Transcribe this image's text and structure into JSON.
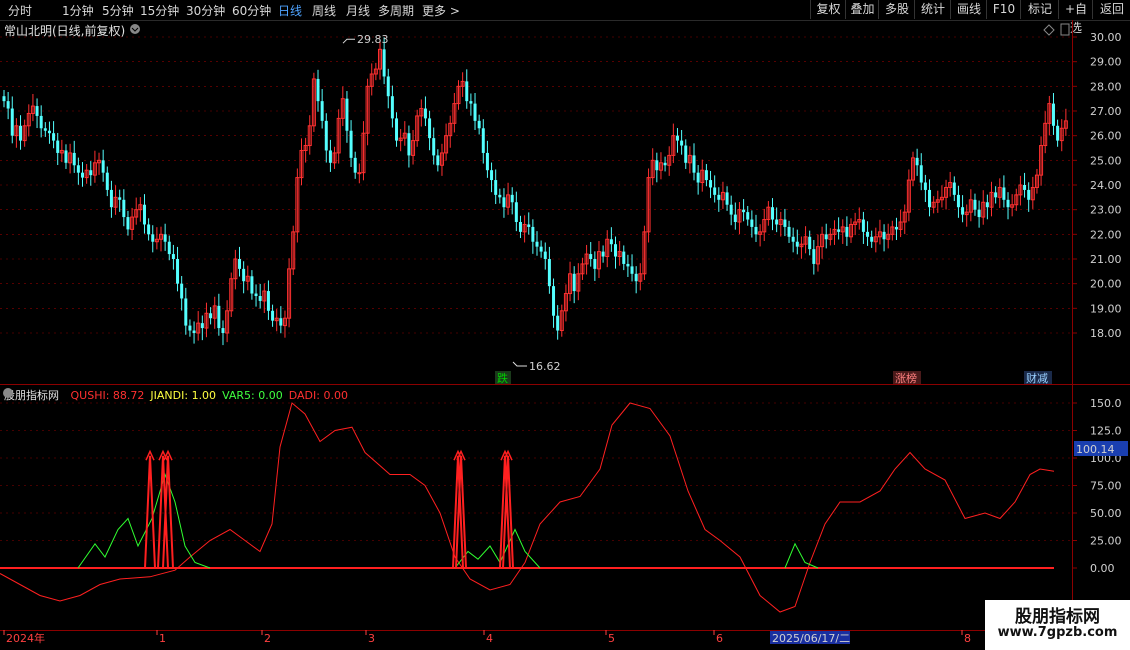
{
  "toolbar": {
    "periods": [
      "分时",
      "1分钟",
      "5分钟",
      "15分钟",
      "30分钟",
      "60分钟",
      "日线",
      "周线",
      "月线",
      "多周期",
      "更多 >"
    ],
    "active_period": "日线",
    "actions": [
      "复权",
      "叠加",
      "多股",
      "统计",
      "画线",
      "F10",
      "标记",
      "+自选",
      "返回"
    ]
  },
  "main_chart": {
    "title": "常山北明(日线,前复权)",
    "price_ticks": [
      "30.00",
      "29.00",
      "28.00",
      "27.00",
      "26.00",
      "25.00",
      "24.00",
      "23.00",
      "22.00",
      "21.00",
      "20.00",
      "19.00",
      "18.00"
    ],
    "high_label": "29.83",
    "low_label": "16.62",
    "signals": [
      {
        "text": "跌",
        "color": "#00d000",
        "bg": "#1a3a1a"
      },
      {
        "text": "涨榜",
        "color": "#ff8080",
        "bg": "#4a1a1a"
      },
      {
        "text": "财减",
        "color": "#9ad0ff",
        "bg": "#1a2a4a"
      }
    ]
  },
  "indicator": {
    "name": "股朋指标网",
    "values": [
      {
        "label": "QUSHI: 88.72",
        "color": "#ff3030"
      },
      {
        "label": "JIANDI: 1.00",
        "color": "#ffff40"
      },
      {
        "label": "VAR5: 0.00",
        "color": "#40ff40"
      },
      {
        "label": "DADI: 0.00",
        "color": "#ff3030"
      }
    ],
    "ticks": [
      "150.0",
      "125.0",
      "100.0",
      "75.00",
      "50.00",
      "25.00",
      "0.00"
    ],
    "current_value": "100.14"
  },
  "date_axis": {
    "labels": [
      "2024年",
      "1",
      "2",
      "3",
      "4",
      "5",
      "6",
      "8"
    ],
    "cursor_date": "2025/06/17/二"
  },
  "watermark": {
    "line1": "股朋指标网",
    "line2": "www.7gpzb.com"
  },
  "colors": {
    "up": "#ff3030",
    "down": "#54ffff",
    "grid": "#8b0000",
    "quishi": "#ff2020",
    "var5": "#30ff30"
  },
  "chart_data": {
    "type": "candlestick",
    "title": "常山北明(日线,前复权)",
    "ylim": [
      17.3,
      30.3
    ],
    "closes": [
      27.4,
      27.1,
      26.0,
      26.4,
      25.8,
      26.4,
      26.9,
      27.2,
      26.8,
      26.3,
      26.2,
      26.1,
      25.8,
      25.3,
      25.4,
      24.9,
      25.3,
      24.8,
      24.5,
      24.3,
      24.6,
      24.4,
      24.9,
      25.0,
      24.5,
      23.8,
      23.1,
      23.5,
      23.4,
      22.7,
      22.2,
      22.7,
      23.0,
      23.2,
      22.4,
      22.0,
      21.7,
      21.8,
      22.0,
      21.7,
      21.2,
      21.0,
      20.0,
      19.4,
      18.3,
      18.1,
      18.0,
      18.4,
      18.2,
      18.8,
      18.6,
      19.1,
      18.2,
      18.0,
      18.9,
      20.2,
      21.0,
      20.6,
      20.1,
      20.3,
      19.6,
      19.5,
      19.3,
      19.7,
      18.9,
      18.5,
      18.6,
      18.3,
      18.6,
      20.6,
      22.1,
      24.3,
      25.4,
      25.6,
      26.4,
      28.3,
      27.4,
      26.6,
      25.4,
      24.9,
      25.3,
      26.7,
      27.5,
      26.2,
      25.1,
      24.5,
      24.5,
      26.1,
      28.0,
      28.5,
      28.7,
      29.5,
      28.4,
      27.6,
      26.7,
      25.8,
      25.9,
      26.1,
      25.2,
      25.8,
      26.8,
      27.1,
      26.7,
      25.9,
      25.2,
      24.8,
      25.3,
      26.0,
      26.5,
      27.3,
      28.0,
      28.2,
      27.4,
      27.3,
      26.6,
      26.3,
      25.3,
      24.6,
      24.2,
      23.6,
      23.5,
      23.1,
      23.6,
      23.3,
      22.5,
      22.1,
      22.4,
      22.3,
      21.7,
      21.5,
      21.3,
      21.0,
      19.9,
      18.7,
      18.1,
      18.9,
      19.6,
      20.4,
      19.7,
      20.4,
      20.8,
      21.2,
      21.0,
      20.6,
      21.3,
      21.1,
      21.8,
      21.6,
      21.1,
      21.3,
      20.8,
      20.7,
      20.4,
      20.1,
      20.4,
      22.1,
      24.3,
      25.0,
      24.6,
      24.9,
      24.8,
      25.2,
      26.0,
      25.8,
      25.6,
      24.9,
      25.2,
      24.5,
      24.1,
      24.6,
      24.2,
      23.9,
      23.6,
      23.4,
      23.7,
      23.2,
      22.8,
      22.5,
      23.0,
      22.9,
      22.6,
      22.3,
      22.0,
      22.1,
      22.6,
      23.1,
      22.6,
      22.4,
      22.6,
      22.3,
      21.9,
      21.7,
      21.5,
      21.6,
      21.9,
      21.4,
      20.8,
      21.5,
      22.0,
      21.8,
      22.0,
      22.2,
      22.1,
      22.3,
      21.9,
      22.4,
      22.5,
      22.6,
      22.1,
      21.9,
      21.7,
      21.9,
      22.1,
      21.8,
      22.0,
      22.3,
      22.2,
      22.5,
      22.9,
      24.2,
      25.1,
      24.8,
      24.1,
      23.8,
      23.1,
      23.3,
      23.4,
      23.5,
      23.9,
      24.1,
      23.6,
      23.1,
      22.8,
      22.9,
      23.4,
      23.0,
      22.7,
      23.3,
      23.1,
      23.7,
      23.5,
      23.9,
      23.4,
      23.1,
      23.2,
      23.6,
      24.0,
      23.8,
      23.4,
      23.9,
      24.4,
      25.6,
      26.5,
      27.3,
      26.4,
      25.8,
      26.3,
      26.6
    ]
  }
}
